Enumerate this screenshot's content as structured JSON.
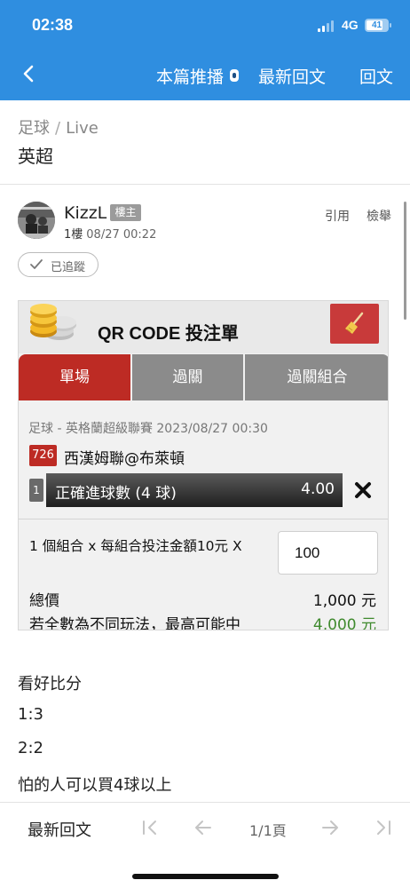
{
  "status_bar": {
    "time": "02:38",
    "network": "4G",
    "battery": "41"
  },
  "nav": {
    "push_label": "本篇推播",
    "latest_label": "最新回文",
    "reply_label": "回文"
  },
  "breadcrumb": {
    "category": "足球",
    "separator": "/",
    "subcategory": "Live"
  },
  "thread": {
    "title": "英超"
  },
  "post": {
    "author": "KizzL",
    "author_badge": "樓主",
    "floor": "1樓",
    "timestamp": "08/27 00:22",
    "quote_label": "引用",
    "report_label": "檢舉",
    "tracked_label": "已追蹤",
    "bet_slip": {
      "title": "QR CODE 投注單",
      "tabs": [
        {
          "label": "單場",
          "active": true
        },
        {
          "label": "過關",
          "active": false
        },
        {
          "label": "過關組合",
          "active": false
        }
      ],
      "match_info": "足球 - 英格蘭超級聯賽 2023/08/27 00:30",
      "match_number": "726",
      "match_name": "西漢姆聯@布萊頓",
      "selection_index": "1",
      "selection_option": "正確進球數 (4 球)",
      "selection_odds": "4.00",
      "combo_text": "1 個組合 x 每組合投注金額10元 X",
      "amount": "100",
      "total_label": "總價",
      "total_value": "1,000 元",
      "max_label": "若全數為不同玩法，最高可能中",
      "max_value": "4,000 元"
    },
    "body_lines": [
      "看好比分",
      "1:3",
      "2:2",
      "怕的人可以買4球以上"
    ]
  },
  "pager": {
    "latest_label": "最新回文",
    "page_count": "1/1頁"
  },
  "colors": {
    "header_blue": "#2f8ee0",
    "slip_red": "#bd2b24",
    "tab_gray": "#8b8b8b",
    "win_green": "#3f8a2e"
  }
}
